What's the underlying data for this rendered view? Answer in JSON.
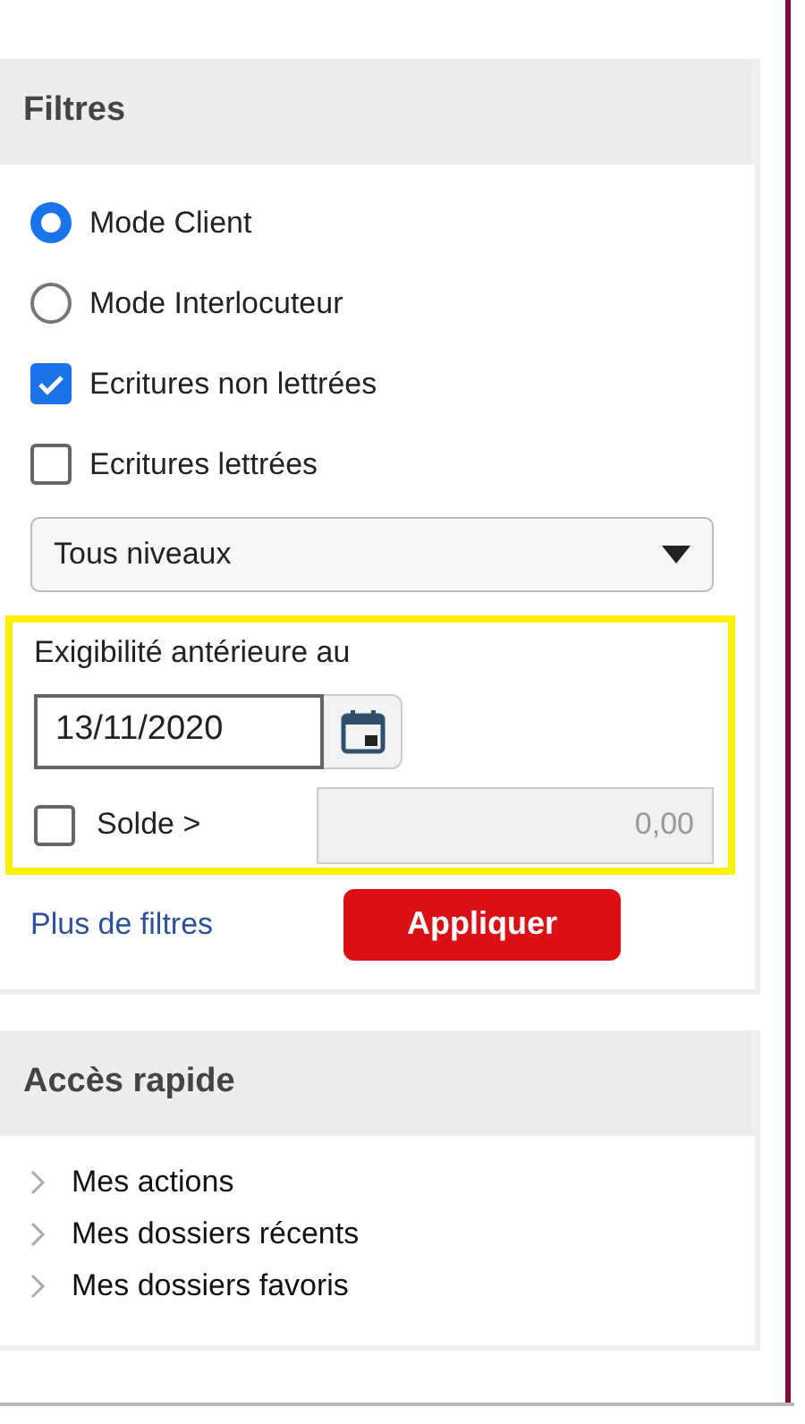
{
  "filters": {
    "title": "Filtres",
    "modes": [
      {
        "label": "Mode Client",
        "selected": true
      },
      {
        "label": "Mode Interlocuteur",
        "selected": false
      }
    ],
    "options": [
      {
        "label": "Ecritures non lettrées",
        "checked": true
      },
      {
        "label": "Ecritures lettrées",
        "checked": false
      }
    ],
    "level_select": {
      "value": "Tous niveaux"
    },
    "due_date": {
      "label": "Exigibilité antérieure au",
      "value": "13/11/2020",
      "highlighted": true
    },
    "balance": {
      "label": "Solde >",
      "checked": false,
      "placeholder": "0,00",
      "disabled": true
    },
    "more_filters_link": "Plus de filtres",
    "apply_button": "Appliquer"
  },
  "quick_access": {
    "title": "Accès rapide",
    "items": [
      "Mes actions",
      "Mes dossiers récents",
      "Mes dossiers favoris"
    ]
  }
}
